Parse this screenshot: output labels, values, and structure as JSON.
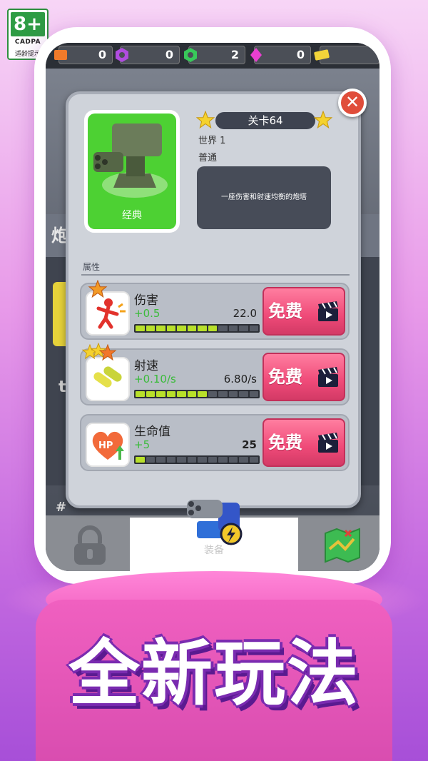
{
  "age_badge": {
    "rating": "8+",
    "org": "CADPA",
    "tip": "适龄提示"
  },
  "resources": [
    {
      "icon": "orange-crate-icon",
      "value": "0"
    },
    {
      "icon": "purple-nut-icon",
      "value": "0"
    },
    {
      "icon": "green-nut-icon",
      "value": "2"
    },
    {
      "icon": "pink-gem-icon",
      "value": "0"
    },
    {
      "icon": "yellow-ticket-icon",
      "value": ""
    }
  ],
  "background": {
    "partial_text_1": "炮",
    "partial_text_2": "t",
    "partial_text_3": "#"
  },
  "dialog": {
    "item_label": "经典",
    "level": "关卡64",
    "world": "世界 1",
    "mode": "普通",
    "description": "一座伤害和射速均衡的炮塔",
    "attributes_title": "属性",
    "attributes": [
      {
        "name": "伤害",
        "increment": "+0.5",
        "value": "22.0",
        "level": 8,
        "max": 12,
        "icon": "damage-icon",
        "stars": 1,
        "button": "免费"
      },
      {
        "name": "射速",
        "increment": "+0.10/s",
        "value": "6.80/s",
        "level": 7,
        "max": 12,
        "icon": "fire-rate-icon",
        "stars": 3,
        "button": "免费"
      },
      {
        "name": "生命值",
        "increment": "+5",
        "value": "25",
        "level": 1,
        "max": 12,
        "icon": "hp-heart-icon",
        "stars": 0,
        "button": "免费"
      }
    ]
  },
  "nav": {
    "active_label": "装备"
  },
  "slogan": "全新玩法",
  "colors": {
    "accent_pink": "#ef4a78",
    "green": "#4dd133",
    "increment_green": "#3bbb3b",
    "bar_fill": "#b8e02a"
  }
}
